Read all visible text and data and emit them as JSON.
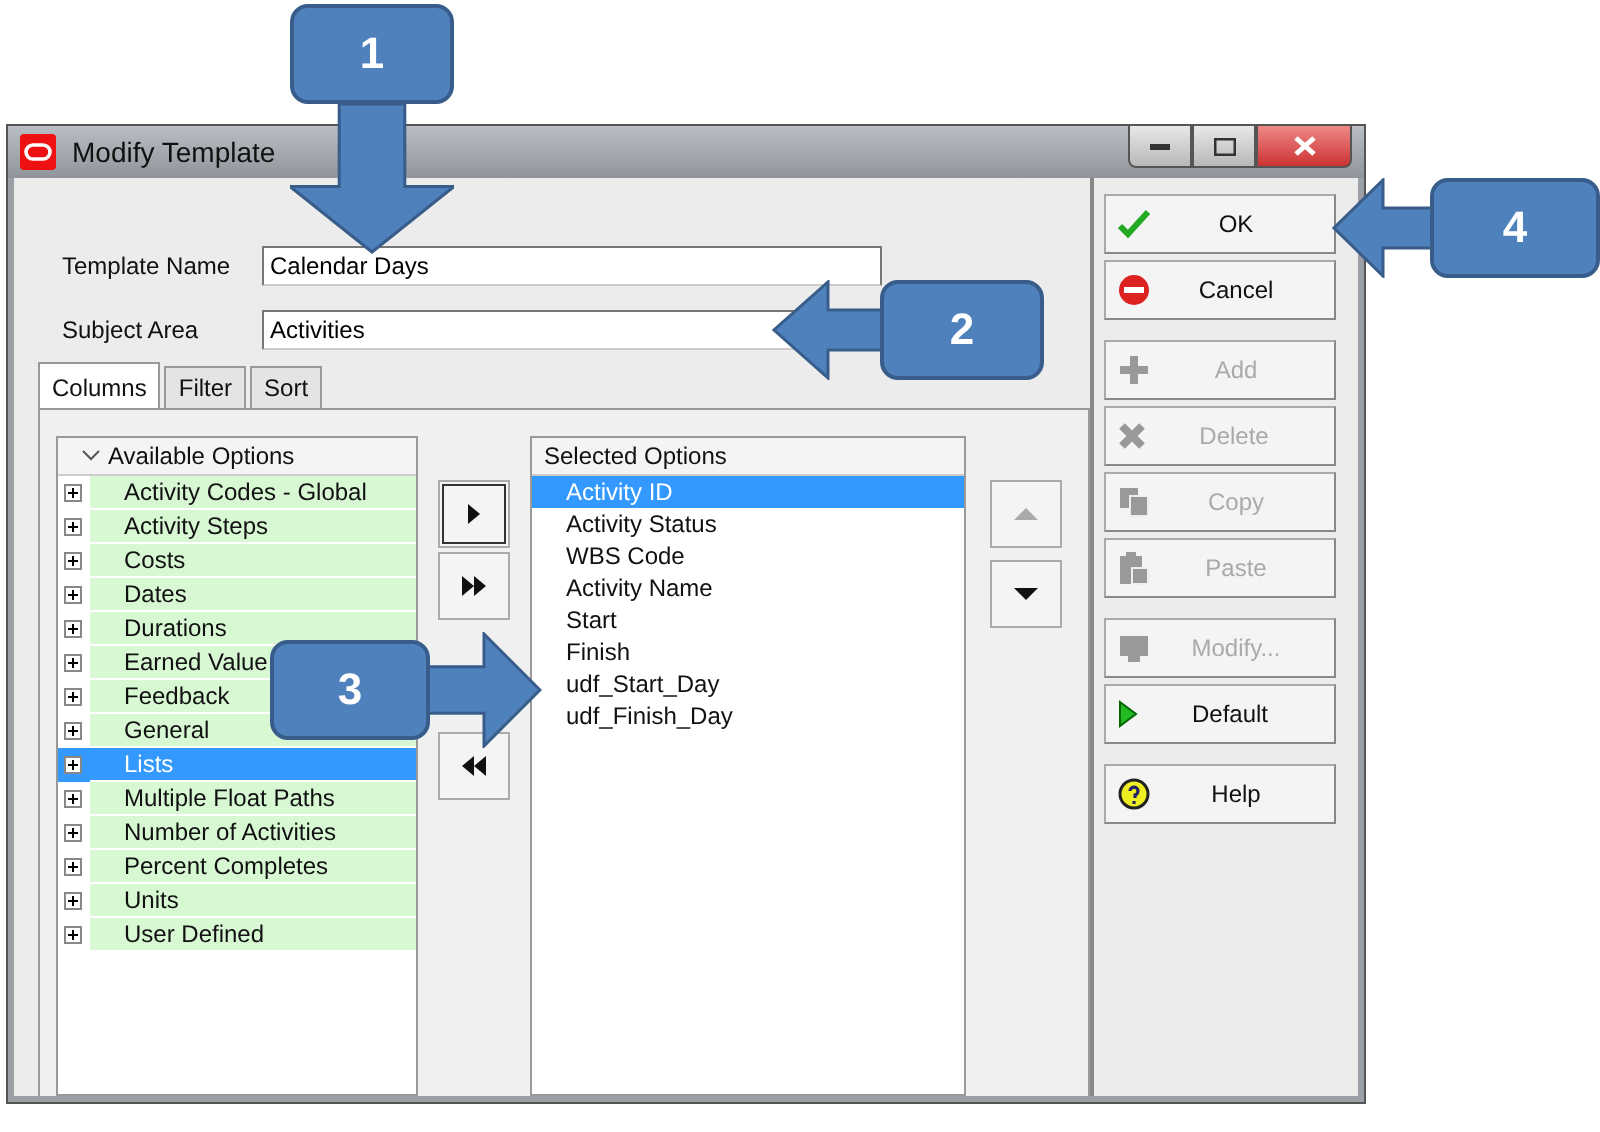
{
  "window": {
    "title": "Modify Template"
  },
  "form": [
    {
      "label": "Template Name",
      "value": "Calendar Days"
    },
    {
      "label": "Subject Area",
      "value": "Activities"
    }
  ],
  "tabs": [
    {
      "label": "Columns",
      "selected": true
    },
    {
      "label": "Filter",
      "selected": false
    },
    {
      "label": "Sort",
      "selected": false
    }
  ],
  "available_options": {
    "header": "Available Options",
    "items": [
      {
        "label": "Activity Codes - Global",
        "selected": false
      },
      {
        "label": "Activity Steps",
        "selected": false
      },
      {
        "label": "Costs",
        "selected": false
      },
      {
        "label": "Dates",
        "selected": false
      },
      {
        "label": "Durations",
        "selected": false
      },
      {
        "label": "Earned Value",
        "selected": false
      },
      {
        "label": "Feedback",
        "selected": false
      },
      {
        "label": "General",
        "selected": false
      },
      {
        "label": "Lists",
        "selected": true
      },
      {
        "label": "Multiple Float Paths",
        "selected": false
      },
      {
        "label": "Number of Activities",
        "selected": false
      },
      {
        "label": "Percent Completes",
        "selected": false
      },
      {
        "label": "Units",
        "selected": false
      },
      {
        "label": "User Defined",
        "selected": false
      }
    ]
  },
  "selected_options": {
    "header": "Selected Options",
    "items": [
      {
        "label": "Activity ID",
        "selected": true
      },
      {
        "label": "Activity Status",
        "selected": false
      },
      {
        "label": "WBS Code",
        "selected": false
      },
      {
        "label": "Activity Name",
        "selected": false
      },
      {
        "label": "Start",
        "selected": false
      },
      {
        "label": "Finish",
        "selected": false
      },
      {
        "label": "udf_Start_Day",
        "selected": false
      },
      {
        "label": "udf_Finish_Day",
        "selected": false
      }
    ]
  },
  "move_buttons": [
    {
      "kind": "add",
      "disabled": false
    },
    {
      "kind": "addall",
      "disabled": false
    },
    {
      "kind": "removeall",
      "disabled": false
    }
  ],
  "order_buttons": [
    {
      "kind": "up",
      "disabled": true
    },
    {
      "kind": "down",
      "disabled": false
    }
  ],
  "button_groups": [
    [
      {
        "kind": "ok",
        "label": "OK",
        "disabled": false
      },
      {
        "kind": "cancel",
        "label": "Cancel",
        "disabled": false
      }
    ],
    [
      {
        "kind": "add",
        "label": "Add",
        "disabled": true
      },
      {
        "kind": "delete",
        "label": "Delete",
        "disabled": true
      },
      {
        "kind": "copy",
        "label": "Copy",
        "disabled": true
      },
      {
        "kind": "paste",
        "label": "Paste",
        "disabled": true
      }
    ],
    [
      {
        "kind": "modify",
        "label": "Modify...",
        "disabled": true
      },
      {
        "kind": "default",
        "label": "Default",
        "disabled": false
      }
    ],
    [
      {
        "kind": "help",
        "label": "Help",
        "disabled": false
      }
    ]
  ],
  "callouts": [
    {
      "label": "1"
    },
    {
      "label": "2"
    },
    {
      "label": "3"
    },
    {
      "label": "4"
    }
  ]
}
